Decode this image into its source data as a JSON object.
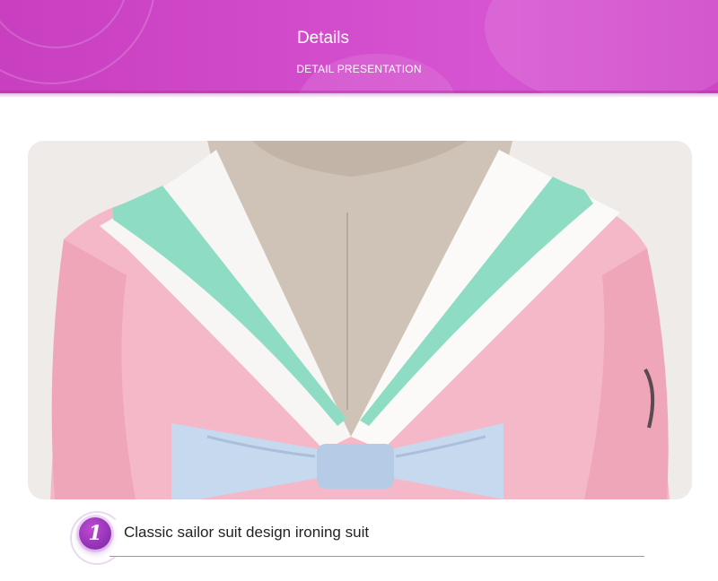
{
  "header": {
    "title": "Details",
    "subtitle": "DETAIL PRESENTATION",
    "background_color": "#d24ccc"
  },
  "photo": {
    "subject": "pink-sailor-suit-collar-and-bow"
  },
  "feature": {
    "number": "1",
    "text": "Classic sailor suit design ironing suit",
    "badge_color": "#a03cc4"
  }
}
